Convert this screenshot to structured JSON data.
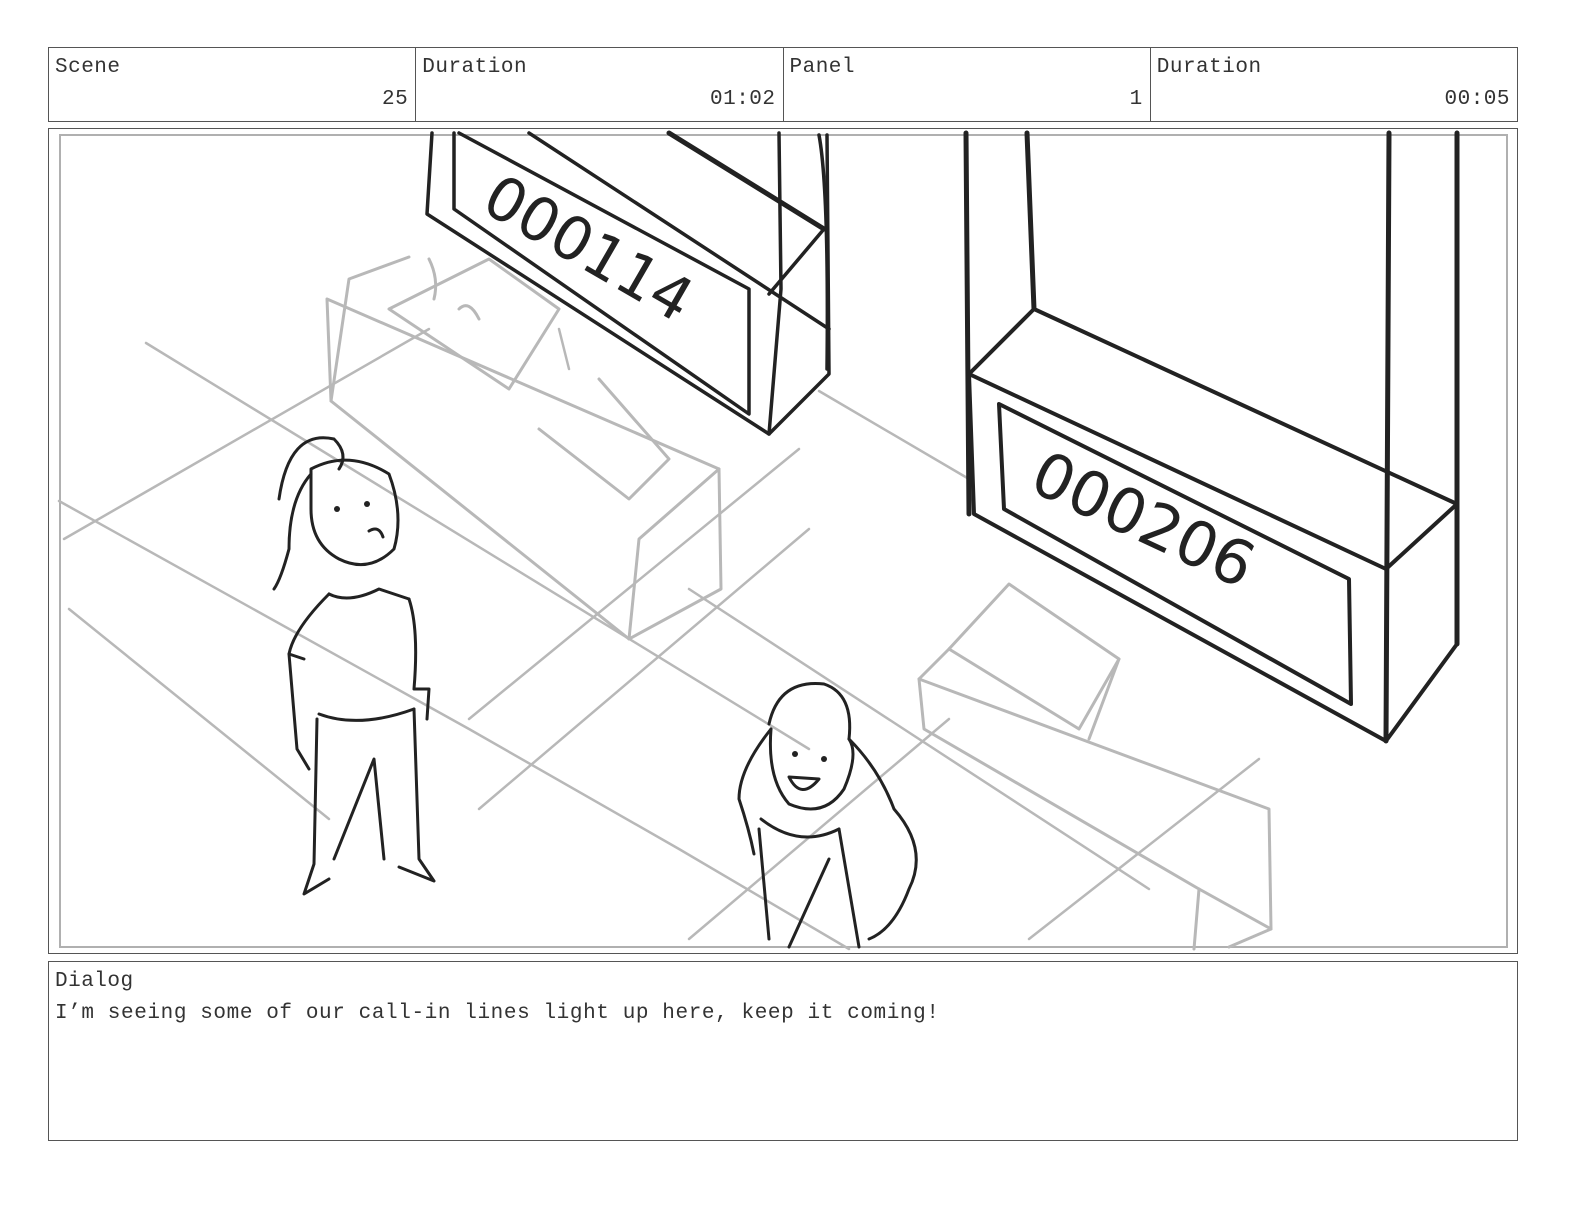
{
  "header": {
    "scene": {
      "label": "Scene",
      "value": "25"
    },
    "scene_duration": {
      "label": "Duration",
      "value": "01:02"
    },
    "panel": {
      "label": "Panel",
      "value": "1"
    },
    "panel_duration": {
      "label": "Duration",
      "value": "00:05"
    }
  },
  "artwork": {
    "counter_left": "000114",
    "counter_right": "000206"
  },
  "dialog": {
    "label": "Dialog",
    "text": "I’m seeing some of our call-in lines light up here, keep it coming!"
  }
}
